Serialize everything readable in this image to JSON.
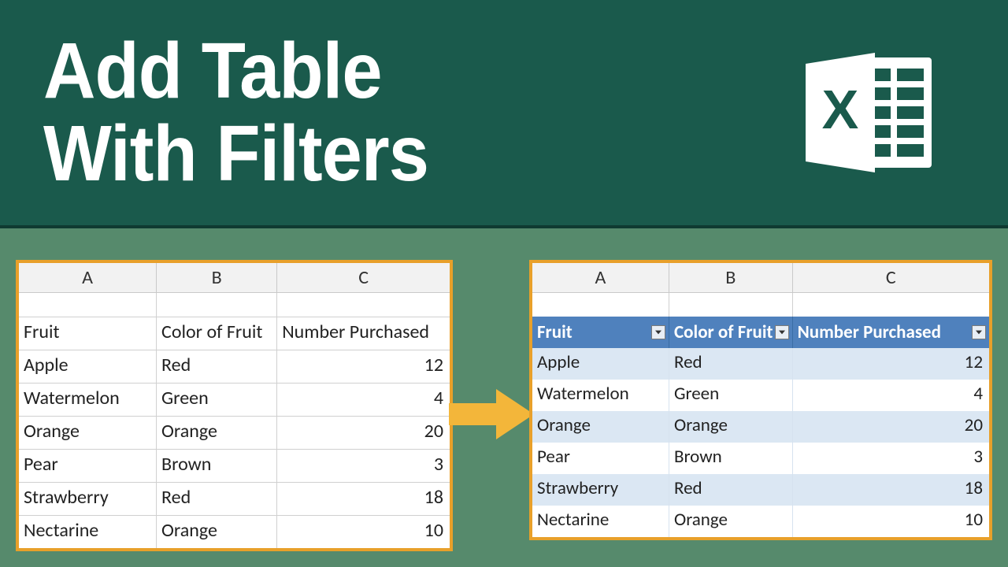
{
  "title_line1": "Add Table",
  "title_line2": "With Filters",
  "columns": {
    "a": "A",
    "b": "B",
    "c": "C"
  },
  "headers": {
    "fruit": "Fruit",
    "color": "Color of Fruit",
    "number": "Number Purchased"
  },
  "rows": [
    {
      "fruit": "Apple",
      "color": "Red",
      "number": "12"
    },
    {
      "fruit": "Watermelon",
      "color": "Green",
      "number": "4"
    },
    {
      "fruit": "Orange",
      "color": "Orange",
      "number": "20"
    },
    {
      "fruit": "Pear",
      "color": "Brown",
      "number": "3"
    },
    {
      "fruit": "Strawberry",
      "color": "Red",
      "number": "18"
    },
    {
      "fruit": "Nectarine",
      "color": "Orange",
      "number": "10"
    }
  ],
  "colors": {
    "banner": "#1a5a4c",
    "lower_bg": "#568a6c",
    "frame": "#e8a02a",
    "arrow": "#f3b63a",
    "table_header": "#4f81bd",
    "band_a": "#dbe7f3",
    "band_b": "#ffffff"
  }
}
